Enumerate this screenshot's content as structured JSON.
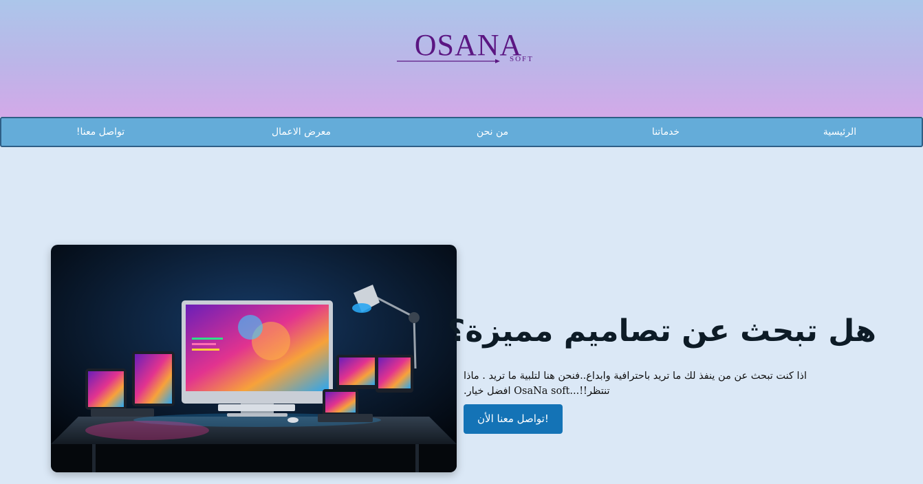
{
  "brand": {
    "logo_main": "OSANA",
    "logo_sub": "SOFT",
    "logo_color": "#5b1682"
  },
  "nav": {
    "items": [
      {
        "label": "الرئيسية"
      },
      {
        "label": "خدماتنا"
      },
      {
        "label": "من نحن"
      },
      {
        "label": "معرض الاعمال"
      },
      {
        "label": "تواصل معنا!"
      }
    ]
  },
  "hero": {
    "title": "هل تبحث عن تصاميم مميزة؟",
    "description": "اذا كنت تبحث عن من ينفذ لك ما تريد باحترافية وابداع..فنحن هنا لتلبية ما تريد . ماذا تنتظر!!...OsaNa soft افضل خيار.",
    "cta_label": "تواصل معنا الأن!",
    "image_icon": "devices-workspace-illustration"
  },
  "colors": {
    "page_bg": "#dbe8f6",
    "nav_bg": "#64acd9",
    "cta_bg": "#1473b6"
  }
}
